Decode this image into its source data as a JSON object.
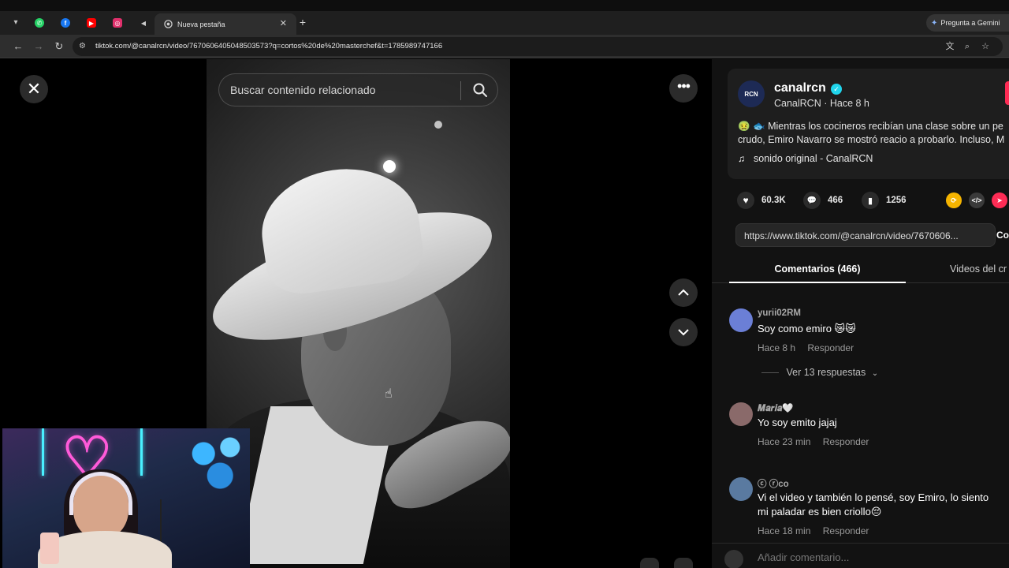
{
  "browser": {
    "active_tab_title": "Nueva pestaña",
    "url": "tiktok.com/@canalrcn/video/7670606405048503573?q=cortos%20de%20masterchef&t=1785989747166",
    "gemini_label": "Pregunta a Gemini",
    "pinned_tabs": [
      {
        "icon": "whatsapp-icon",
        "color": "#25d366",
        "glyph": "✆"
      },
      {
        "icon": "facebook-icon",
        "color": "#1877f2",
        "glyph": "f"
      },
      {
        "icon": "youtube-icon",
        "color": "#ff0000",
        "glyph": "▶"
      },
      {
        "icon": "instagram-icon",
        "color": "#e1306c",
        "glyph": "◎"
      },
      {
        "icon": "speaker-icon",
        "color": "#3a3a3a",
        "glyph": "🔈"
      }
    ]
  },
  "player": {
    "search_placeholder": "Buscar contenido relacionado"
  },
  "author": {
    "username": "canalrcn",
    "display_and_time": "CanalRCN · Hace 8 h",
    "avatar_label": "RCN",
    "description_line1": "🤢 🐟 Mientras los cocineros recibían una clase sobre un pe",
    "description_line2": "crudo, Emiro Navarro se mostró reacio a probarlo. Incluso, M",
    "music": "sonido original - CanalRCN"
  },
  "stats": {
    "likes": "60.3K",
    "comments": "466",
    "saves": "1256"
  },
  "share": {
    "link": "https://www.tiktok.com/@canalrcn/video/7670606...",
    "copy_label": "Co"
  },
  "tabs": {
    "comments": "Comentarios (466)",
    "creator_videos": "Videos del cr"
  },
  "comments": [
    {
      "user": "yurii02RM",
      "text": "Soy como emiro 😿😿",
      "time": "Hace 8 h",
      "reply": "Responder",
      "avatar_color": "#6b7fd6"
    },
    {
      "user": "𝑴𝒂𝒓𝒊𝒂🤍",
      "text": "Yo soy emito jajaj",
      "time": "Hace 23 min",
      "reply": "Responder",
      "avatar_color": "#8a6a6a"
    },
    {
      "user": "ⓒ ⓡco",
      "text": "Vi el video y también lo pensé, soy Emiro, lo siento",
      "text2": "mi paladar es bien criollo😔",
      "time": "Hace 18 min",
      "reply": "Responder",
      "avatar_color": "#5a7aa0"
    }
  ],
  "view_replies": "Ver 13 respuestas",
  "add_comment_placeholder": "Añadir comentario..."
}
